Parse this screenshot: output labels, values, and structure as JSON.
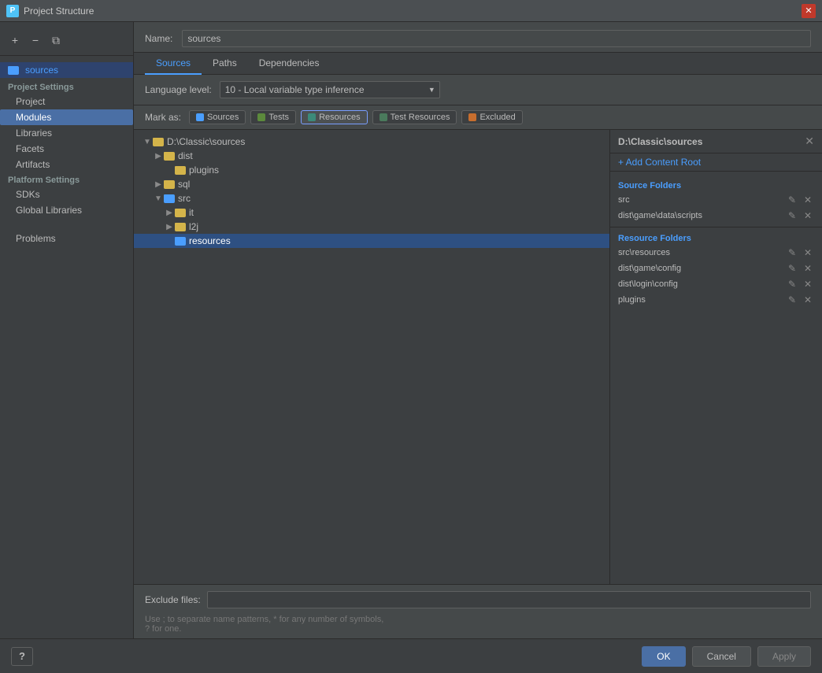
{
  "titleBar": {
    "icon": "P",
    "title": "Project Structure",
    "closeBtn": "✕"
  },
  "sidebar": {
    "toolbar": {
      "addBtn": "+",
      "removeBtn": "−",
      "copyBtn": "⧉"
    },
    "selectedItem": {
      "name": "sources",
      "icon": "folder"
    },
    "projectSettings": {
      "label": "Project Settings",
      "items": [
        {
          "id": "project",
          "label": "Project"
        },
        {
          "id": "modules",
          "label": "Modules"
        },
        {
          "id": "libraries",
          "label": "Libraries"
        },
        {
          "id": "facets",
          "label": "Facets"
        },
        {
          "id": "artifacts",
          "label": "Artifacts"
        }
      ]
    },
    "platformSettings": {
      "label": "Platform Settings",
      "items": [
        {
          "id": "sdks",
          "label": "SDKs"
        },
        {
          "id": "global-libraries",
          "label": "Global Libraries"
        }
      ]
    },
    "extraItems": [
      {
        "id": "problems",
        "label": "Problems"
      }
    ]
  },
  "nameRow": {
    "label": "Name:",
    "value": "sources"
  },
  "tabs": [
    {
      "id": "sources",
      "label": "Sources",
      "active": true
    },
    {
      "id": "paths",
      "label": "Paths"
    },
    {
      "id": "dependencies",
      "label": "Dependencies"
    }
  ],
  "languageRow": {
    "label": "Language level:",
    "value": "10 - Local variable type inference"
  },
  "markAs": {
    "label": "Mark as:",
    "buttons": [
      {
        "id": "sources",
        "label": "Sources",
        "dotClass": "dot-blue",
        "active": false
      },
      {
        "id": "tests",
        "label": "Tests",
        "dotClass": "dot-green",
        "active": false
      },
      {
        "id": "resources",
        "label": "Resources",
        "dotClass": "dot-cyan",
        "active": true
      },
      {
        "id": "test-resources",
        "label": "Test Resources",
        "dotClass": "dot-teal",
        "active": false
      },
      {
        "id": "excluded",
        "label": "Excluded",
        "dotClass": "dot-orange",
        "active": false
      }
    ]
  },
  "tree": {
    "items": [
      {
        "id": "root",
        "label": "D:\\Classic\\sources",
        "indent": 0,
        "expanded": true,
        "isRoot": true
      },
      {
        "id": "dist",
        "label": "dist",
        "indent": 1,
        "expanded": false
      },
      {
        "id": "plugins",
        "label": "plugins",
        "indent": 2,
        "expanded": false
      },
      {
        "id": "sql",
        "label": "sql",
        "indent": 1,
        "expanded": false
      },
      {
        "id": "src",
        "label": "src",
        "indent": 1,
        "expanded": true
      },
      {
        "id": "it",
        "label": "it",
        "indent": 2,
        "expanded": false
      },
      {
        "id": "l2j",
        "label": "l2j",
        "indent": 2,
        "expanded": false
      },
      {
        "id": "resources",
        "label": "resources",
        "indent": 2,
        "expanded": false,
        "selected": true
      }
    ]
  },
  "rightPanel": {
    "title": "D:\\Classic\\sources",
    "closeBtn": "✕",
    "addContentRoot": "+ Add Content Root",
    "sourceFolders": {
      "label": "Source Folders",
      "items": [
        {
          "id": "src",
          "label": "src"
        },
        {
          "id": "dist-scripts",
          "label": "dist\\game\\data\\scripts"
        }
      ]
    },
    "resourceFolders": {
      "label": "Resource Folders",
      "items": [
        {
          "id": "src-resources",
          "label": "src\\resources"
        },
        {
          "id": "dist-game-config",
          "label": "dist\\game\\config"
        },
        {
          "id": "dist-login-config",
          "label": "dist\\login\\config"
        },
        {
          "id": "plugins",
          "label": "plugins"
        }
      ]
    },
    "editIcon": "✎",
    "removeIcon": "✕"
  },
  "excludeRow": {
    "label": "Exclude files:",
    "value": "",
    "placeholder": ""
  },
  "hintText": "Use ; to separate name patterns, * for any number of symbols,\n? for one.",
  "footer": {
    "helpLabel": "?",
    "okLabel": "OK",
    "cancelLabel": "Cancel",
    "applyLabel": "Apply"
  }
}
